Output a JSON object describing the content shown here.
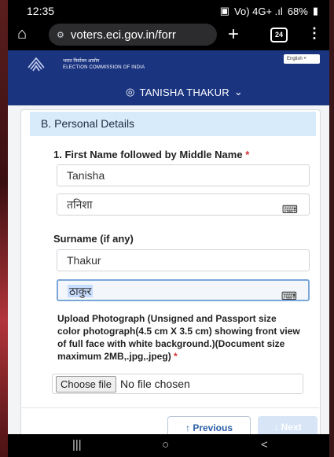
{
  "status_bar": {
    "time": "12:35",
    "indicators": "Vo) 4G+ .ıl",
    "battery": "68%"
  },
  "browser": {
    "url": "voters.eci.gov.in/forr",
    "tab_count": "24"
  },
  "site": {
    "org_name_hi": "भारत निर्वाचन आयोग",
    "org_name_en": "ELECTION COMMISSION OF INDIA",
    "language": "English"
  },
  "user": {
    "name": "TANISHA THAKUR"
  },
  "form": {
    "section_title": "B. Personal Details",
    "first_name_label": "1. First Name followed by Middle Name",
    "required_mark": "*",
    "first_name_en": "Tanisha",
    "first_name_hi": "तनिशा",
    "surname_label": "Surname (if any)",
    "surname_en": "Thakur",
    "surname_hi": "ठाकुर",
    "photo_label": "Upload Photograph (Unsigned and Passport size color photograph(4.5 cm X 3.5 cm) showing front view of full face with white background.)(Document size maximum 2MB,.jpg,.jpeg)",
    "file_button": "Choose file",
    "file_status": "No file chosen",
    "previous_label": "↑ Previous",
    "next_label": "↓ Next"
  },
  "colors": {
    "header_bg": "#1a3480",
    "section_bg": "#d8ebfa",
    "required": "#d32f2f"
  }
}
